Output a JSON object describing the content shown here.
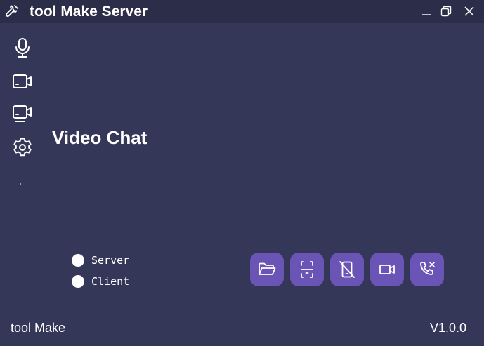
{
  "window": {
    "title": "tool Make Server",
    "app_icon": "wrench-icon",
    "controls": [
      "minimize-icon",
      "restore-icon",
      "close-icon"
    ]
  },
  "sidebar": {
    "items": [
      {
        "icon": "microphone-icon"
      },
      {
        "icon": "video-camera-icon"
      },
      {
        "icon": "screen-share-icon"
      },
      {
        "icon": "settings-gear-icon"
      }
    ]
  },
  "main": {
    "title": "Video Chat"
  },
  "mode": {
    "options": [
      {
        "label": "Server",
        "selected": false
      },
      {
        "label": "Client",
        "selected": false
      }
    ]
  },
  "actions": [
    {
      "icon": "folder-open-icon"
    },
    {
      "icon": "scan-phone-icon"
    },
    {
      "icon": "phone-off-icon"
    },
    {
      "icon": "video-icon"
    },
    {
      "icon": "end-call-icon"
    }
  ],
  "footer": {
    "brand": "tool Make",
    "version": "V1.0.0"
  },
  "colors": {
    "background": "#353758",
    "titlebar": "#2c2d48",
    "button": "#6a55b6",
    "text": "#ffffff"
  }
}
